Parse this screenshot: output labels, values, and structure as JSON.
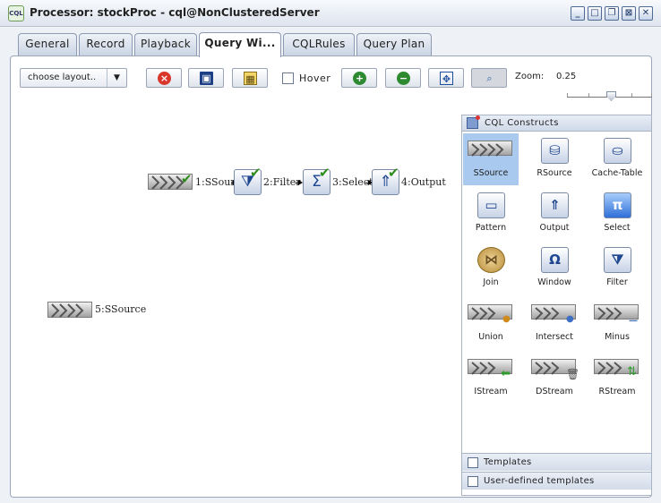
{
  "window": {
    "title": "Processor: stockProc - cql@NonClusteredServer",
    "app_icon_text": "CQL"
  },
  "tabs": [
    {
      "label": "General",
      "active": false
    },
    {
      "label": "Record",
      "active": false
    },
    {
      "label": "Playback",
      "active": false
    },
    {
      "label": "Query Wi...",
      "active": true
    },
    {
      "label": "CQLRules",
      "active": false
    },
    {
      "label": "Query Plan",
      "active": false
    }
  ],
  "toolbar": {
    "layout_select_value": "choose layout..",
    "hover_label": "Hover",
    "hover_checked": false,
    "zoom_label": "Zoom:",
    "zoom_value": "0.25"
  },
  "canvas": {
    "nodes": [
      {
        "label": "1:SSource",
        "type": "ssource",
        "validated": true
      },
      {
        "label": "2:Filter",
        "type": "filter",
        "validated": true
      },
      {
        "label": "3:Select",
        "type": "select",
        "validated": true
      },
      {
        "label": "4:Output",
        "type": "output",
        "validated": true
      },
      {
        "label": "5:SSource",
        "type": "ssource",
        "validated": false
      }
    ]
  },
  "palette": {
    "title": "CQL Constructs",
    "items": [
      {
        "label": "SSource",
        "icon": "stream-source-icon",
        "selected": true
      },
      {
        "label": "RSource",
        "icon": "relation-source-icon"
      },
      {
        "label": "Cache-Table",
        "icon": "cache-table-icon"
      },
      {
        "label": "Pattern",
        "icon": "pattern-icon"
      },
      {
        "label": "Output",
        "icon": "output-icon"
      },
      {
        "label": "Select",
        "icon": "select-pi-icon"
      },
      {
        "label": "Join",
        "icon": "join-bowtie-icon"
      },
      {
        "label": "Window",
        "icon": "window-omega-icon"
      },
      {
        "label": "Filter",
        "icon": "filter-icon"
      },
      {
        "label": "Union",
        "icon": "union-icon"
      },
      {
        "label": "Intersect",
        "icon": "intersect-icon"
      },
      {
        "label": "Minus",
        "icon": "minus-icon"
      },
      {
        "label": "IStream",
        "icon": "istream-icon"
      },
      {
        "label": "DStream",
        "icon": "dstream-icon"
      },
      {
        "label": "RStream",
        "icon": "rstream-icon"
      }
    ],
    "footer": [
      {
        "label": "Templates"
      },
      {
        "label": "User-defined templates"
      }
    ]
  }
}
